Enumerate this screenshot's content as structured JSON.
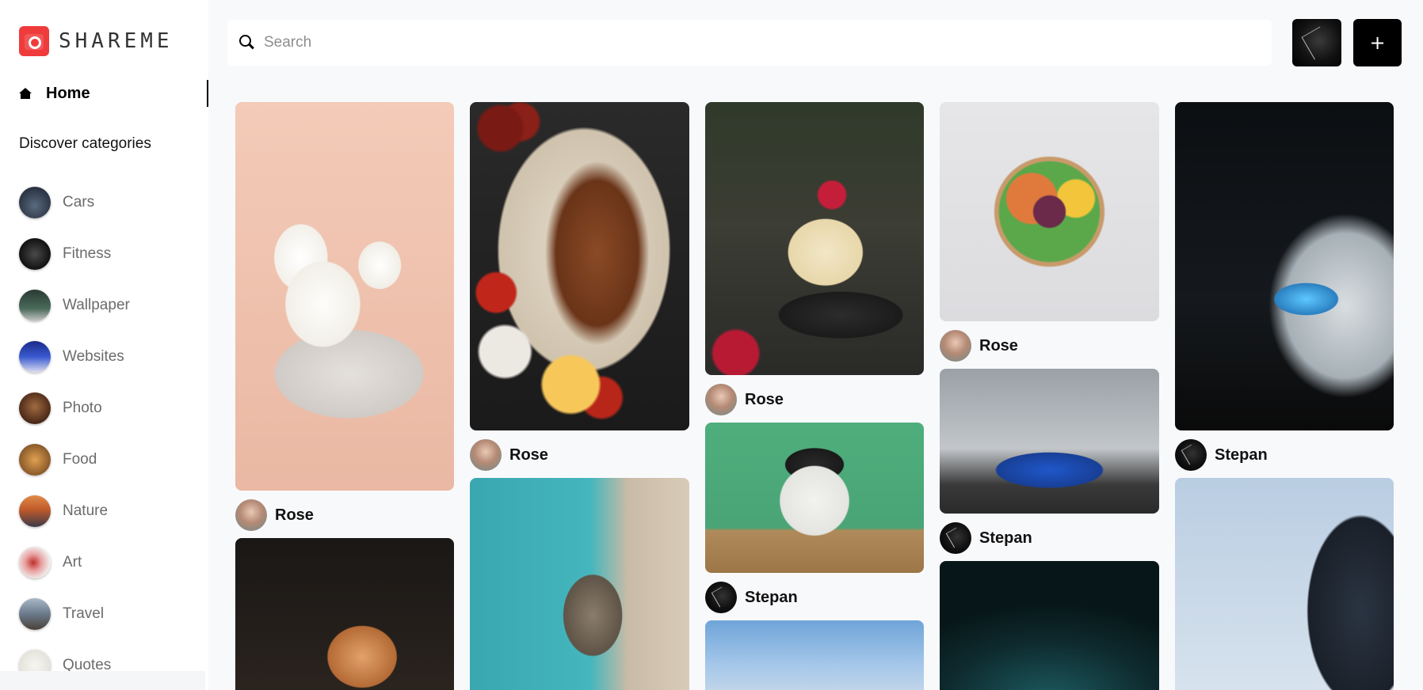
{
  "logo": {
    "text": "SHAREME"
  },
  "nav": {
    "home_label": "Home"
  },
  "sidebar": {
    "discover_label": "Discover categories",
    "categories": [
      {
        "label": "Cars",
        "color": "#3b4a5e"
      },
      {
        "label": "Fitness",
        "color": "#2a2a2a"
      },
      {
        "label": "Wallpaper",
        "color": "#3d5a4a"
      },
      {
        "label": "Websites",
        "color": "#2a3a8a"
      },
      {
        "label": "Photo",
        "color": "#5a3420"
      },
      {
        "label": "Food",
        "color": "#b07a3a"
      },
      {
        "label": "Nature",
        "color": "#c06a3a"
      },
      {
        "label": "Art",
        "color": "#e0d6d2"
      },
      {
        "label": "Travel",
        "color": "#7a8a9a"
      },
      {
        "label": "Quotes",
        "color": "#ecebe6"
      }
    ]
  },
  "search": {
    "placeholder": "Search",
    "value": ""
  },
  "topbar": {
    "add_label": "+"
  },
  "pins": [
    {
      "author": "Rose",
      "avatar": "rose",
      "image": "cake"
    },
    {
      "author": "",
      "avatar": "",
      "image": "dog"
    },
    {
      "author": "Rose",
      "avatar": "rose",
      "image": "bbq"
    },
    {
      "author": "",
      "avatar": "",
      "image": "cat"
    },
    {
      "author": "Rose",
      "avatar": "rose",
      "image": "raspberry-cake"
    },
    {
      "author": "Stepan",
      "avatar": "stepan",
      "image": "cat"
    },
    {
      "author": "",
      "avatar": "",
      "image": "temple"
    },
    {
      "author": "Rose",
      "avatar": "rose",
      "image": "salad"
    },
    {
      "author": "Stepan",
      "avatar": "stepan",
      "image": "blue-car"
    },
    {
      "author": "",
      "avatar": "",
      "image": "dark-teal"
    },
    {
      "author": "Stepan",
      "avatar": "stepan",
      "image": "car-headlight"
    },
    {
      "author": "",
      "avatar": "",
      "image": "building"
    }
  ]
}
